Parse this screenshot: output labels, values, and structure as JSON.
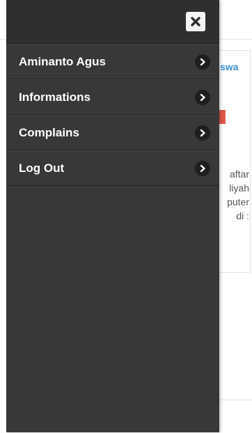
{
  "drawer": {
    "close_icon": "close-icon",
    "items": [
      {
        "label": "Aminanto Agus",
        "icon": "chevron-right-icon"
      },
      {
        "label": "Informations",
        "icon": "chevron-right-icon"
      },
      {
        "label": "Complains",
        "icon": "chevron-right-icon"
      },
      {
        "label": "Log Out",
        "icon": "chevron-right-icon"
      }
    ]
  },
  "background": {
    "card_title_fragment": "swa",
    "card_text_fragments": [
      "aftar",
      "liyah",
      "puter",
      "di :"
    ]
  },
  "colors": {
    "drawer_bg": "#383838",
    "header_bg": "#2f2f2f",
    "link_blue": "#3a8ed0",
    "badge_red": "#e0574a"
  }
}
